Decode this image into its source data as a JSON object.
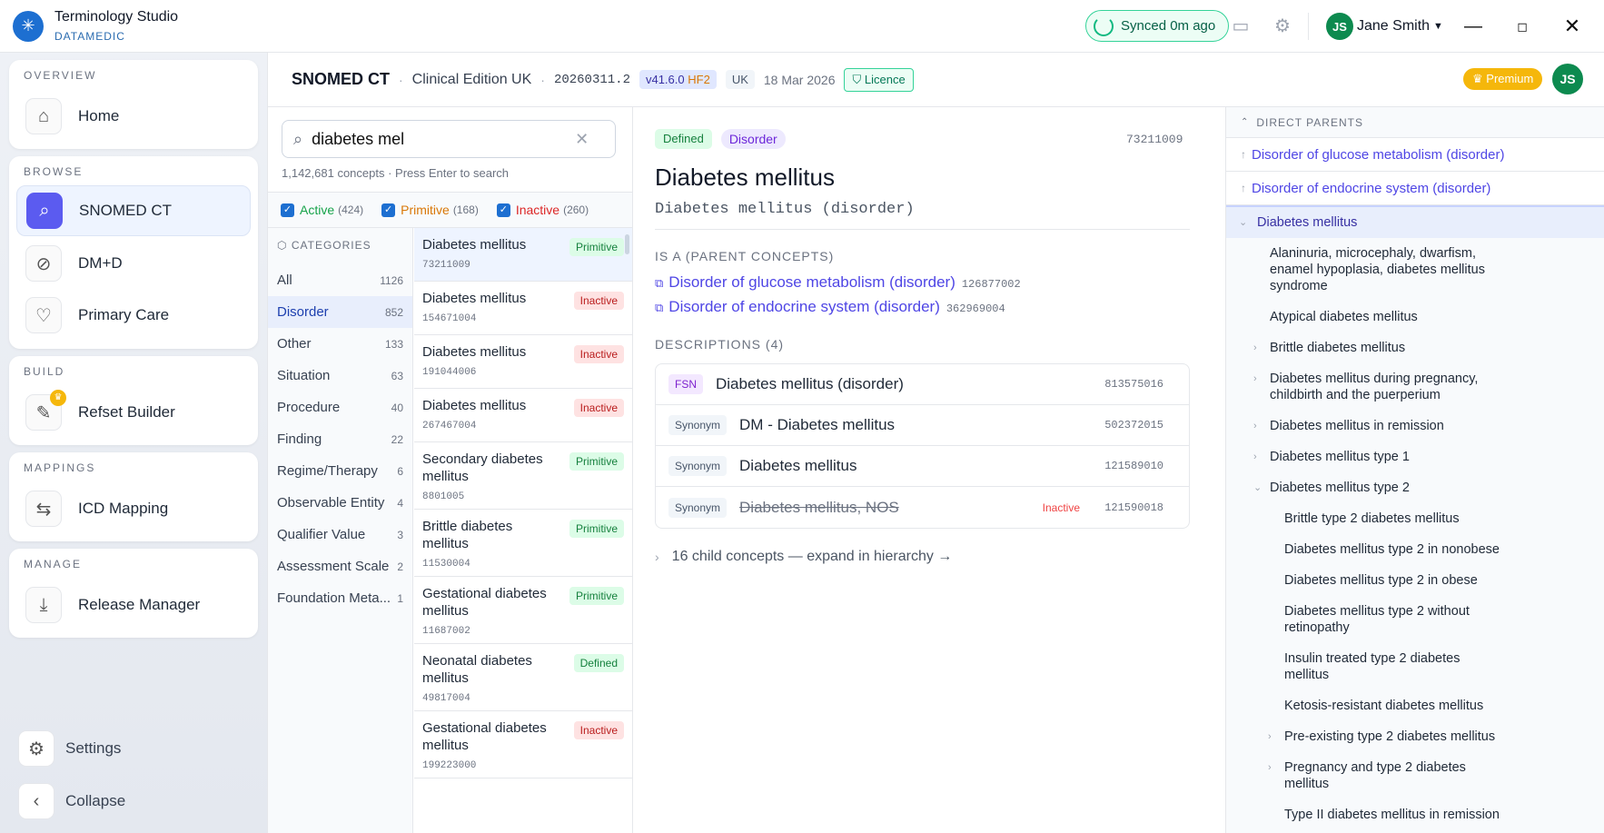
{
  "titlebar": {
    "app_name": "Terminology Studio",
    "company": "DATAMEDIC",
    "sync_status": "Synced 0m ago",
    "user_initials": "JS",
    "user_name": "Jane Smith"
  },
  "sidebar": {
    "sections": {
      "overview": "OVERVIEW",
      "browse": "BROWSE",
      "build": "BUILD",
      "mappings": "MAPPINGS",
      "manage": "MANAGE"
    },
    "items": {
      "home": "Home",
      "snomed": "SNOMED CT",
      "dmd": "DM+D",
      "primary_care": "Primary Care",
      "refset_builder": "Refset Builder",
      "icd_mapping": "ICD Mapping",
      "release_manager": "Release Manager"
    },
    "settings": "Settings",
    "collapse": "Collapse"
  },
  "header": {
    "title": "SNOMED CT",
    "edition": "Clinical Edition UK",
    "release": "20260311.2",
    "version": "v41.6.0",
    "hotfix": "HF2",
    "country": "UK",
    "date": "18 Mar 2026",
    "licence": "Licence",
    "premium": "Premium",
    "avatar": "JS"
  },
  "search": {
    "value": "diabetes mel",
    "count_text": "1,142,681 concepts · Press Enter to search"
  },
  "filters": [
    {
      "label": "Active",
      "count": "(424)",
      "color": "#16a34a"
    },
    {
      "label": "Primitive",
      "count": "(168)",
      "color": "#d97706"
    },
    {
      "label": "Inactive",
      "count": "(260)",
      "color": "#dc2626"
    }
  ],
  "categories_title": "CATEGORIES",
  "categories": [
    {
      "name": "All",
      "count": "1126"
    },
    {
      "name": "Disorder",
      "count": "852"
    },
    {
      "name": "Other",
      "count": "133"
    },
    {
      "name": "Situation",
      "count": "63"
    },
    {
      "name": "Procedure",
      "count": "40"
    },
    {
      "name": "Finding",
      "count": "22"
    },
    {
      "name": "Regime/Therapy",
      "count": "6"
    },
    {
      "name": "Observable Entity",
      "count": "4"
    },
    {
      "name": "Qualifier Value",
      "count": "3"
    },
    {
      "name": "Assessment Scale",
      "count": "2"
    },
    {
      "name": "Foundation Meta...",
      "count": "1"
    }
  ],
  "results": [
    {
      "name": "Diabetes mellitus",
      "id": "73211009",
      "badge": "Primitive",
      "kind": "prim"
    },
    {
      "name": "Diabetes mellitus",
      "id": "154671004",
      "badge": "Inactive",
      "kind": "inact"
    },
    {
      "name": "Diabetes mellitus",
      "id": "191044006",
      "badge": "Inactive",
      "kind": "inact"
    },
    {
      "name": "Diabetes mellitus",
      "id": "267467004",
      "badge": "Inactive",
      "kind": "inact"
    },
    {
      "name": "Secondary diabetes mellitus",
      "id": "8801005",
      "badge": "Primitive",
      "kind": "prim"
    },
    {
      "name": "Brittle diabetes mellitus",
      "id": "11530004",
      "badge": "Primitive",
      "kind": "prim"
    },
    {
      "name": "Gestational diabetes mellitus",
      "id": "11687002",
      "badge": "Primitive",
      "kind": "prim"
    },
    {
      "name": "Neonatal diabetes mellitus",
      "id": "49817004",
      "badge": "Defined",
      "kind": "def"
    },
    {
      "name": "Gestational diabetes mellitus",
      "id": "199223000",
      "badge": "Inactive",
      "kind": "inact"
    }
  ],
  "detail": {
    "status": "Defined",
    "semantic_tag": "Disorder",
    "concept_id": "73211009",
    "title": "Diabetes mellitus",
    "fsn": "Diabetes mellitus (disorder)",
    "isa_heading": "IS A (PARENT CONCEPTS)",
    "parents": [
      {
        "name": "Disorder of glucose metabolism (disorder)",
        "id": "126877002"
      },
      {
        "name": "Disorder of endocrine system (disorder)",
        "id": "362969004"
      }
    ],
    "desc_heading": "DESCRIPTIONS (4)",
    "descriptions": [
      {
        "type": "FSN",
        "term": "Diabetes mellitus (disorder)",
        "id": "813575016",
        "inactive": ""
      },
      {
        "type": "Synonym",
        "term": "DM - Diabetes mellitus",
        "id": "502372015",
        "inactive": ""
      },
      {
        "type": "Synonym",
        "term": "Diabetes mellitus",
        "id": "121589010",
        "inactive": ""
      },
      {
        "type": "Synonym",
        "term": "Diabetes mellitus, NOS",
        "id": "121590018",
        "inactive": "Inactive"
      }
    ],
    "children_text": "16 child concepts — expand in hierarchy →"
  },
  "tree": {
    "heading": "DIRECT PARENTS",
    "parents": [
      "Disorder of glucose metabolism (disorder)",
      "Disorder of endocrine system (disorder)"
    ],
    "current": "Diabetes mellitus",
    "children": [
      {
        "label": "Alaninuria, microcephaly, dwarfism, enamel hypoplasia, diabetes mellitus syndrome",
        "chev": "",
        "level": 1
      },
      {
        "label": "Atypical diabetes mellitus",
        "chev": "",
        "level": 1
      },
      {
        "label": "Brittle diabetes mellitus",
        "chev": "›",
        "level": 1
      },
      {
        "label": "Diabetes mellitus during pregnancy, childbirth and the puerperium",
        "chev": "›",
        "level": 1
      },
      {
        "label": "Diabetes mellitus in remission",
        "chev": "›",
        "level": 1
      },
      {
        "label": "Diabetes mellitus type 1",
        "chev": "›",
        "level": 1
      },
      {
        "label": "Diabetes mellitus type 2",
        "chev": "⌄",
        "level": 1
      },
      {
        "label": "Brittle type 2 diabetes mellitus",
        "chev": "",
        "level": 2
      },
      {
        "label": "Diabetes mellitus type 2 in nonobese",
        "chev": "",
        "level": 2
      },
      {
        "label": "Diabetes mellitus type 2 in obese",
        "chev": "",
        "level": 2
      },
      {
        "label": "Diabetes mellitus type 2 without retinopathy",
        "chev": "",
        "level": 2
      },
      {
        "label": "Insulin treated type 2 diabetes mellitus",
        "chev": "",
        "level": 2
      },
      {
        "label": "Ketosis-resistant diabetes mellitus",
        "chev": "",
        "level": 2
      },
      {
        "label": "Pre-existing type 2 diabetes mellitus",
        "chev": "›",
        "level": 2
      },
      {
        "label": "Pregnancy and type 2 diabetes mellitus",
        "chev": "›",
        "level": 2
      },
      {
        "label": "Type II diabetes mellitus in remission",
        "chev": "",
        "level": 2
      }
    ]
  }
}
